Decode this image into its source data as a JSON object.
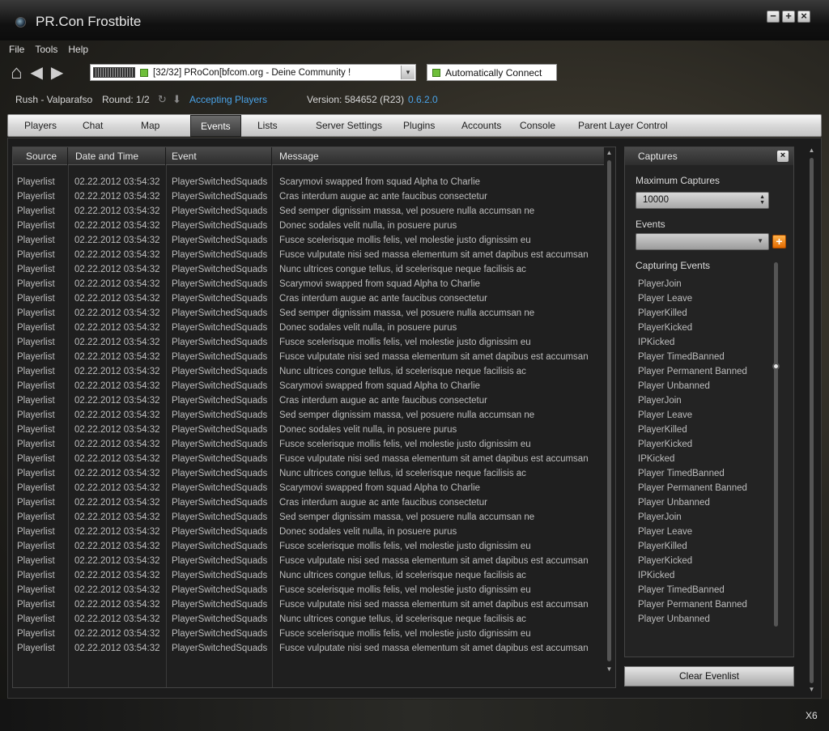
{
  "window": {
    "title": "PR.Con Frostbite",
    "minimize": "−",
    "maximize": "+",
    "close": "×"
  },
  "menu": [
    "File",
    "Tools",
    "Help"
  ],
  "nav": {
    "home": "⌂",
    "back": "◀",
    "forward": "▶"
  },
  "server": {
    "selected": "[32/32] PRoCon[bfcom.org - Deine Community !",
    "dropdown_arrow": "▾"
  },
  "auto_connect": {
    "label": "Automatically Connect"
  },
  "status": {
    "map": "Rush - Valparafso",
    "round": "Round: 1/2",
    "refresh": "↻",
    "download": "⬇",
    "state": "Accepting Players",
    "version": "Version: 584652 (R23)",
    "client_version": "0.6.2.0"
  },
  "tabs": [
    "Players",
    "Chat",
    "Map",
    "Events",
    "Lists",
    "Server Settings",
    "Plugins",
    "Accounts",
    "Console",
    "Parent Layer Control"
  ],
  "active_tab": "Events",
  "events_table": {
    "headers": [
      "Source",
      "Date and Time",
      "Event",
      "Message"
    ],
    "rows": [
      [
        "Playerlist",
        "02.22.2012 03:54:32",
        "PlayerSwitchedSquads",
        "Scarymovi swapped from squad Alpha to Charlie"
      ],
      [
        "Playerlist",
        "02.22.2012 03:54:32",
        "PlayerSwitchedSquads",
        "Cras interdum augue ac ante faucibus consectetur"
      ],
      [
        "Playerlist",
        "02.22.2012 03:54:32",
        "PlayerSwitchedSquads",
        "Sed semper dignissim massa, vel posuere nulla accumsan ne"
      ],
      [
        "Playerlist",
        "02.22.2012 03:54:32",
        "PlayerSwitchedSquads",
        "Donec sodales velit nulla, in posuere purus"
      ],
      [
        "Playerlist",
        "02.22.2012 03:54:32",
        "PlayerSwitchedSquads",
        "Fusce scelerisque mollis felis, vel molestie justo dignissim eu"
      ],
      [
        "Playerlist",
        "02.22.2012 03:54:32",
        "PlayerSwitchedSquads",
        "Fusce vulputate nisi sed massa elementum sit amet dapibus est accumsan"
      ],
      [
        "Playerlist",
        "02.22.2012 03:54:32",
        "PlayerSwitchedSquads",
        "Nunc ultrices congue tellus, id scelerisque neque facilisis ac"
      ],
      [
        "Playerlist",
        "02.22.2012 03:54:32",
        "PlayerSwitchedSquads",
        "Scarymovi swapped from squad Alpha to Charlie"
      ],
      [
        "Playerlist",
        "02.22.2012 03:54:32",
        "PlayerSwitchedSquads",
        "Cras interdum augue ac ante faucibus consectetur"
      ],
      [
        "Playerlist",
        "02.22.2012 03:54:32",
        "PlayerSwitchedSquads",
        "Sed semper dignissim massa, vel posuere nulla accumsan ne"
      ],
      [
        "Playerlist",
        "02.22.2012 03:54:32",
        "PlayerSwitchedSquads",
        "Donec sodales velit nulla, in posuere purus"
      ],
      [
        "Playerlist",
        "02.22.2012 03:54:32",
        "PlayerSwitchedSquads",
        "Fusce scelerisque mollis felis, vel molestie justo dignissim eu"
      ],
      [
        "Playerlist",
        "02.22.2012 03:54:32",
        "PlayerSwitchedSquads",
        "Fusce vulputate nisi sed massa elementum sit amet dapibus est accumsan"
      ],
      [
        "Playerlist",
        "02.22.2012 03:54:32",
        "PlayerSwitchedSquads",
        "Nunc ultrices congue tellus, id scelerisque neque facilisis ac"
      ],
      [
        "Playerlist",
        "02.22.2012 03:54:32",
        "PlayerSwitchedSquads",
        "Scarymovi swapped from squad Alpha to Charlie"
      ],
      [
        "Playerlist",
        "02.22.2012 03:54:32",
        "PlayerSwitchedSquads",
        "Cras interdum augue ac ante faucibus consectetur"
      ],
      [
        "Playerlist",
        "02.22.2012 03:54:32",
        "PlayerSwitchedSquads",
        "Sed semper dignissim massa, vel posuere nulla accumsan ne"
      ],
      [
        "Playerlist",
        "02.22.2012 03:54:32",
        "PlayerSwitchedSquads",
        "Donec sodales velit nulla, in posuere purus"
      ],
      [
        "Playerlist",
        "02.22.2012 03:54:32",
        "PlayerSwitchedSquads",
        "Fusce scelerisque mollis felis, vel molestie justo dignissim eu"
      ],
      [
        "Playerlist",
        "02.22.2012 03:54:32",
        "PlayerSwitchedSquads",
        "Fusce vulputate nisi sed massa elementum sit amet dapibus est accumsan"
      ],
      [
        "Playerlist",
        "02.22.2012 03:54:32",
        "PlayerSwitchedSquads",
        "Nunc ultrices congue tellus, id scelerisque neque facilisis ac"
      ],
      [
        "Playerlist",
        "02.22.2012 03:54:32",
        "PlayerSwitchedSquads",
        "Scarymovi swapped from squad Alpha to Charlie"
      ],
      [
        "Playerlist",
        "02.22.2012 03:54:32",
        "PlayerSwitchedSquads",
        "Cras interdum augue ac ante faucibus consectetur"
      ],
      [
        "Playerlist",
        "02.22.2012 03:54:32",
        "PlayerSwitchedSquads",
        "Sed semper dignissim massa, vel posuere nulla accumsan ne"
      ],
      [
        "Playerlist",
        "02.22.2012 03:54:32",
        "PlayerSwitchedSquads",
        "Donec sodales velit nulla, in posuere purus"
      ],
      [
        "Playerlist",
        "02.22.2012 03:54:32",
        "PlayerSwitchedSquads",
        "Fusce scelerisque mollis felis, vel molestie justo dignissim eu"
      ],
      [
        "Playerlist",
        "02.22.2012 03:54:32",
        "PlayerSwitchedSquads",
        "Fusce vulputate nisi sed massa elementum sit amet dapibus est accumsan"
      ],
      [
        "Playerlist",
        "02.22.2012 03:54:32",
        "PlayerSwitchedSquads",
        "Nunc ultrices congue tellus, id scelerisque neque facilisis ac"
      ],
      [
        "Playerlist",
        "02.22.2012 03:54:32",
        "PlayerSwitchedSquads",
        "Fusce scelerisque mollis felis, vel molestie justo dignissim eu"
      ],
      [
        "Playerlist",
        "02.22.2012 03:54:32",
        "PlayerSwitchedSquads",
        "Fusce vulputate nisi sed massa elementum sit amet dapibus est accumsan"
      ],
      [
        "Playerlist",
        "02.22.2012 03:54:32",
        "PlayerSwitchedSquads",
        "Nunc ultrices congue tellus, id scelerisque neque facilisis ac"
      ],
      [
        "Playerlist",
        "02.22.2012 03:54:32",
        "PlayerSwitchedSquads",
        "Fusce scelerisque mollis felis, vel molestie justo dignissim eu"
      ],
      [
        "Playerlist",
        "02.22.2012 03:54:32",
        "PlayerSwitchedSquads",
        "Fusce vulputate nisi sed massa elementum sit amet dapibus est accumsan"
      ]
    ]
  },
  "captures": {
    "title": "Captures",
    "close": "×",
    "max_label": "Maximum Captures",
    "max_value": "10000",
    "events_label": "Events",
    "events_selected": "",
    "add": "+",
    "capturing_label": "Capturing Events",
    "items": [
      "PlayerJoin",
      "Player Leave",
      "PlayerKilled",
      "PlayerKicked",
      "IPKicked",
      "Player TimedBanned",
      "Player Permanent Banned",
      "Player Unbanned",
      "PlayerJoin",
      "Player Leave",
      "PlayerKilled",
      "PlayerKicked",
      "IPKicked",
      "Player TimedBanned",
      "Player Permanent Banned",
      "Player Unbanned",
      "PlayerJoin",
      "Player Leave",
      "PlayerKilled",
      "PlayerKicked",
      "IPKicked",
      "Player TimedBanned",
      "Player Permanent Banned",
      "Player Unbanned"
    ],
    "clear_button": "Clear Evenlist"
  },
  "footer": {
    "tag": "X6"
  },
  "colors": {
    "accent": "#4aa3e8",
    "add_button": "#f07a10",
    "check": "#6fbf3a"
  }
}
